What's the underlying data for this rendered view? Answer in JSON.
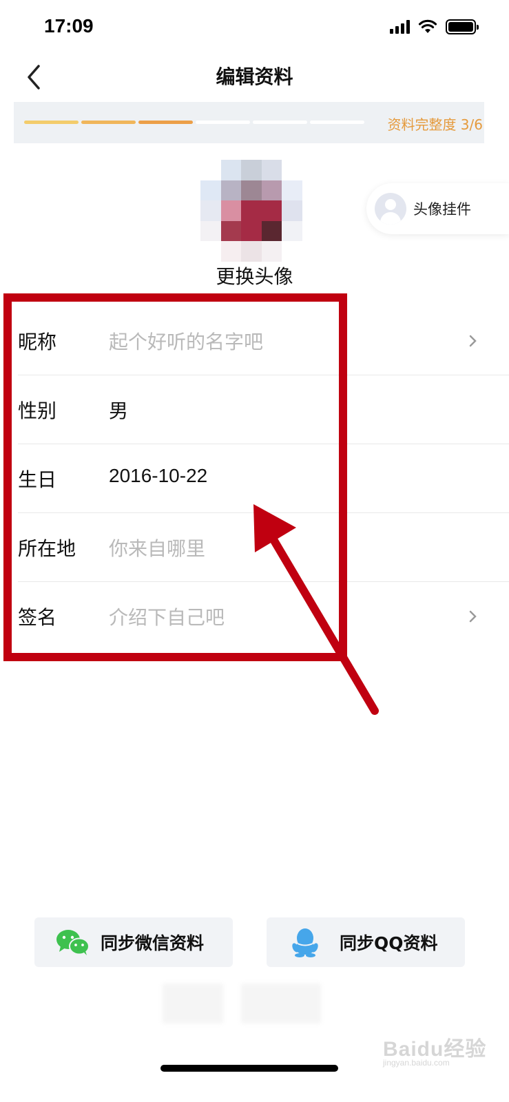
{
  "status_bar": {
    "time": "17:09"
  },
  "nav": {
    "title": "编辑资料",
    "back_icon": "chevron-left-icon"
  },
  "progress": {
    "label": "资料完整度 3/6",
    "filled_segments": 3,
    "total_segments": 6,
    "colors": [
      "#f3cc6b",
      "#f0b65a",
      "#ec9f48"
    ]
  },
  "avatar": {
    "change_label": "更换头像",
    "pixels": [
      [
        "#ffffff",
        "#dbe4f0",
        "#c9cfd9",
        "#d9dde8",
        "#ffffff"
      ],
      [
        "#dfe8f5",
        "#b8b3c4",
        "#9d8794",
        "#b89aae",
        "#e8edf7"
      ],
      [
        "#e6e9f2",
        "#d98fa2",
        "#a52b45",
        "#a52b45",
        "#dfe2ee"
      ],
      [
        "#f3f1f4",
        "#a43a4e",
        "#a52b45",
        "#5a2730",
        "#f1f2f6"
      ],
      [
        "#ffffff",
        "#f6eef0",
        "#ece3e6",
        "#f4f0f2",
        "#ffffff"
      ]
    ]
  },
  "pendant": {
    "label": "头像挂件"
  },
  "form": {
    "rows": [
      {
        "label": "昵称",
        "value": "起个好听的名字吧",
        "placeholder": true,
        "chevron": true
      },
      {
        "label": "性别",
        "value": "男",
        "placeholder": false,
        "chevron": false
      },
      {
        "label": "生日",
        "value": "2016-10-22",
        "placeholder": false,
        "chevron": false
      },
      {
        "label": "所在地",
        "value": "你来自哪里",
        "placeholder": true,
        "chevron": false
      },
      {
        "label": "签名",
        "value": "介绍下自己吧",
        "placeholder": true,
        "chevron": true
      }
    ]
  },
  "sync": {
    "wechat_label": "同步微信资料",
    "qq_label": "同步QQ资料",
    "wechat_color": "#3ec14f",
    "qq_color": "#46a6ea"
  },
  "annotation_color": "#c00010",
  "watermark": {
    "text": "Baidu经验",
    "sub": "jingyan.baidu.com"
  }
}
